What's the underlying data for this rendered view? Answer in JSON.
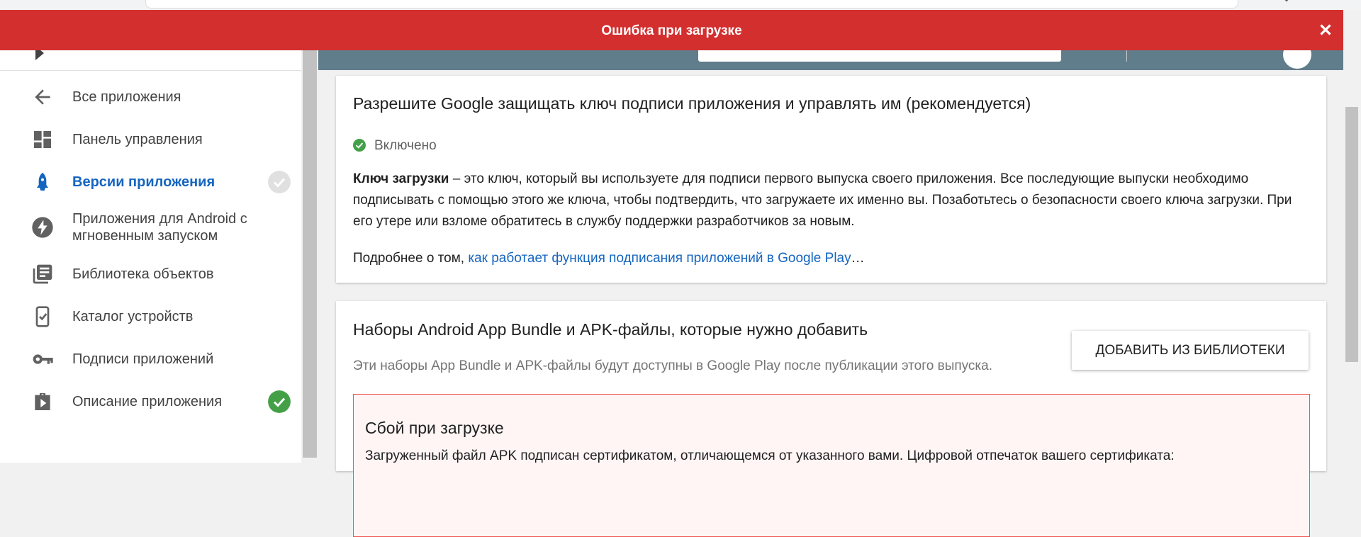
{
  "error_banner": {
    "message": "Ошибка при загрузке",
    "close_icon": "close-icon"
  },
  "sidebar": {
    "items": [
      {
        "label": "Все приложения",
        "icon": "arrow-back-icon"
      },
      {
        "label": "Панель управления",
        "icon": "dashboard-icon"
      },
      {
        "label": "Версии приложения",
        "icon": "rocket-icon",
        "active": true,
        "badge": "check-circle-grey"
      },
      {
        "label": "Приложения для Android с мгновенным запуском",
        "label_line1": "Приложения для Android с",
        "label_line2": "мгновенным запуском",
        "icon": "flash-icon"
      },
      {
        "label": "Библиотека объектов",
        "icon": "library-icon"
      },
      {
        "label": "Каталог устройств",
        "icon": "device-check-icon"
      },
      {
        "label": "Подписи приложений",
        "icon": "key-icon"
      },
      {
        "label": "Описание приложения",
        "icon": "shopping-bag-icon",
        "badge": "check-circle-green"
      }
    ]
  },
  "signing_card": {
    "title": "Разрешите Google защищать ключ подписи приложения и управлять им (рекомендуется)",
    "status": "Включено",
    "desc_bold": "Ключ загрузки",
    "desc_rest": " – это ключ, который вы используете для подписи первого выпуска своего приложения. Все последующие выпуски необходимо подписывать с помощью этого же ключа, чтобы подтвердить, что загружаете их именно вы. Позаботьтесь о безопасности своего ключа загрузки. При его утере или взломе обратитесь в службу поддержки разработчиков за новым.",
    "more_prefix": "Подробнее о том, ",
    "more_link": "как работает функция подписания приложений в Google Play",
    "more_suffix": "…"
  },
  "bundles_card": {
    "title": "Наборы Android App Bundle и APK-файлы, которые нужно добавить",
    "subtitle": "Эти наборы App Bundle и APK-файлы будут доступны в Google Play после публикации этого выпуска.",
    "add_button": "ДОБАВИТЬ ИЗ БИБЛИОТЕКИ",
    "fail_title": "Сбой при загрузке",
    "fail_text": "Загруженный файл APK подписан сертификатом, отличающемся от указанного вами. Цифровой отпечаток вашего сертификата:"
  },
  "colors": {
    "banner": "#d32f2f",
    "header": "#607d8b",
    "accent": "#1565c0",
    "success": "#43a047"
  }
}
